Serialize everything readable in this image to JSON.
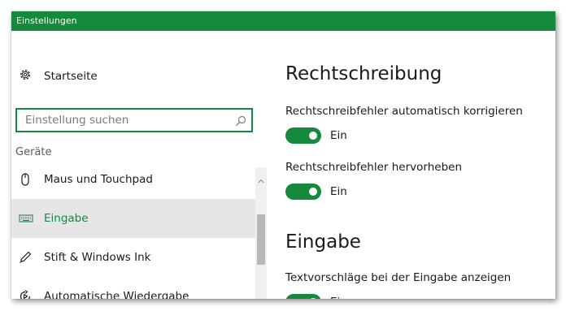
{
  "window": {
    "title": "Einstellungen"
  },
  "colors": {
    "accent": "#168a3c",
    "titlebar": "#168a3c",
    "selection": "#e6e6e6"
  },
  "sidebar": {
    "home": {
      "label": "Startseite",
      "icon": "gear-icon"
    },
    "search": {
      "placeholder": "Einstellung suchen",
      "value": "",
      "icon": "search-icon"
    },
    "section_label": "Geräte",
    "items": [
      {
        "label": "Maus und Touchpad",
        "icon": "mouse-icon",
        "active": false
      },
      {
        "label": "Eingabe",
        "icon": "keyboard-icon",
        "active": true
      },
      {
        "label": "Stift & Windows Ink",
        "icon": "pen-icon",
        "active": false
      },
      {
        "label": "Automatische Wiedergabe",
        "icon": "autoplay-icon",
        "active": false
      }
    ]
  },
  "content": {
    "sections": [
      {
        "heading": "Rechtschreibung",
        "settings": [
          {
            "label": "Rechtschreibfehler automatisch korrigieren",
            "state": "Ein",
            "on": true
          },
          {
            "label": "Rechtschreibfehler hervorheben",
            "state": "Ein",
            "on": true
          }
        ]
      },
      {
        "heading": "Eingabe",
        "settings": [
          {
            "label": "Textvorschläge bei der Eingabe anzeigen",
            "state": "Ein",
            "on": true
          }
        ]
      }
    ]
  }
}
